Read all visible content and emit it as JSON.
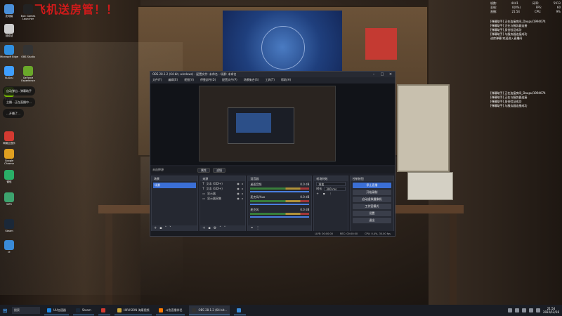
{
  "banner": "…飞机送房管！！",
  "desktop_icons": [
    {
      "label": "此电脑",
      "color": "#4a8fd8"
    },
    {
      "label": "Epic Games Launcher",
      "color": "#222222"
    },
    {
      "label": "回收站",
      "color": "#cccccc"
    },
    {
      "label": "Microsoft Edge",
      "color": "#2f8fe0"
    },
    {
      "label": "OBS Studio",
      "color": "#333333"
    },
    {
      "label": "KuGou",
      "color": "#3f9fff"
    },
    {
      "label": "GeForce Experience",
      "color": "#6aa82a"
    },
    {
      "label": "NVIDIA",
      "color": "#76b900"
    },
    {
      "label": "网易云音乐",
      "color": "#d33a31"
    },
    {
      "label": "Google Chrome",
      "color": "#e0a020"
    },
    {
      "label": "微信",
      "color": "#2aae67"
    },
    {
      "label": "WPS",
      "color": "#3da36e"
    },
    {
      "label": "Steam",
      "color": "#1b2838"
    },
    {
      "label": "ie",
      "color": "#3a8bd8"
    }
  ],
  "notifications": [
    "自动弹出…弹幕助手",
    "主播…正在直播中…",
    "…开播了…"
  ],
  "stats": [
    {
      "label": "帧数:",
      "value": "4441",
      "label2": "码率:",
      "value2": "5913"
    },
    {
      "label": "丢帧:",
      "value": "0(0%)",
      "label2": "FPS:",
      "value2": "60"
    },
    {
      "label": "直播:",
      "value": "21:54",
      "label2": "CPU:",
      "value2": "9%"
    }
  ],
  "chat_log_top": [
    "[弹幕助手] 正在连接房间_Doupu/1994074",
    "[弹幕助手] 正在与服务器连接",
    "[弹幕助手] 身份验证成功",
    "[弹幕助手] 与服务器连接成功",
    "进房弹幕:欢迎进入直播间"
  ],
  "chat_log_bottom": [
    "[弹幕助手] 正在连接房间_Doupu/1994074",
    "[弹幕助手] 正在与服务器连接",
    "[弹幕助手] 身份验证成功",
    "[弹幕助手] 与服务器连接成功"
  ],
  "obs": {
    "title": "OBS 28.1.2 (64-bit, windows) - 配置文件: 未命名 - 场景: 未命名",
    "menu": [
      "文件(F)",
      "编辑(E)",
      "视图(V)",
      "停靠部件(D)",
      "配置文件(P)",
      "场景集合(S)",
      "工具(T)",
      "帮助(H)"
    ],
    "current_scene": "未选择源",
    "props_btn": "属性",
    "filters_btn": "滤镜",
    "docks": {
      "scenes": {
        "title": "场景",
        "items": [
          "场景"
        ]
      },
      "sources": {
        "title": "来源",
        "items": [
          "文本 (GDI+)",
          "文本 (GDI+)",
          "显示器",
          "显示器采集"
        ]
      },
      "mixer": {
        "title": "混音器",
        "channels": [
          {
            "name": "桌面音频",
            "db": "0.0 dB"
          },
          {
            "name": "麦克风/Aux",
            "db": "0.0 dB"
          },
          {
            "name": "麦克风",
            "db": "0.0 dB"
          }
        ]
      },
      "transitions": {
        "title": "转场特效",
        "type": "渐变",
        "duration_label": "时长",
        "duration": "300 ms"
      },
      "controls": {
        "title": "控制按钮",
        "buttons": [
          "停止直播",
          "开始录制",
          "启动虚拟摄像机",
          "工作室模式",
          "设置",
          "退出"
        ]
      }
    },
    "status": [
      "LIVE: 00:00:00",
      "REC: 00:00:00",
      "CPU: 0.4%, 30.00 fps"
    ]
  },
  "taskbar": {
    "search": "搜索",
    "apps": [
      {
        "label": "UU加速器",
        "color": "#1e88e5"
      },
      {
        "label": "Steam",
        "color": "#1b2838"
      },
      {
        "label": "",
        "color": "#d33a31"
      },
      {
        "label": "HKVISION 海康视频",
        "color": "#c9a53a"
      },
      {
        "label": "斗鱼直播伴侣",
        "color": "#ff7a00"
      },
      {
        "label": "OBS 28.1.2 (64-bit...",
        "color": "#333333"
      },
      {
        "label": "",
        "color": "#3a8bd8"
      }
    ],
    "time": "21:54",
    "date": "2022/12/16"
  }
}
